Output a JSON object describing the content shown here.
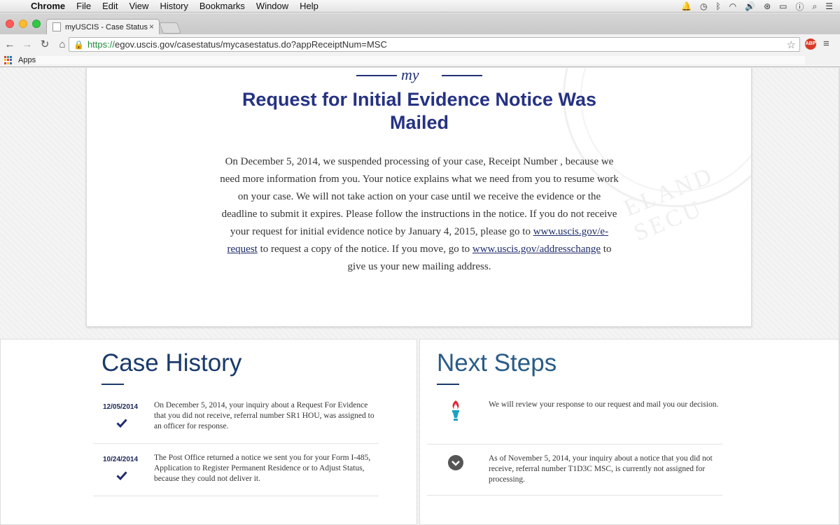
{
  "menubar": {
    "app": "Chrome",
    "items": [
      "File",
      "Edit",
      "View",
      "History",
      "Bookmarks",
      "Window",
      "Help"
    ]
  },
  "browser": {
    "tab_title": "myUSCIS - Case Status",
    "url_https": "https://",
    "url_rest": "egov.uscis.gov/casestatus/mycasestatus.do?appReceiptNum=MSC",
    "apps_label": "Apps",
    "abp_label": "ABP"
  },
  "status": {
    "logo_text": "my",
    "title": "Request for Initial Evidence Notice Was Mailed",
    "body_part1": "On December 5, 2014, we suspended processing of your case, Receipt Number , because we need more information from you. Your notice explains what we need from you to resume work on your case. We will not take action on your case until we receive the evidence or the deadline to submit it expires. Please follow the instructions in the notice. If you do not receive your request for initial evidence notice by January 4, 2015, please go to ",
    "link1": "www.uscis.gov/e-request",
    "body_part2": " to request a copy of the notice. If you move, go to ",
    "link2": "www.uscis.gov/addresschange",
    "body_part3": " to give us your new mailing address."
  },
  "case_history": {
    "title": "Case History",
    "items": [
      {
        "date": "12/05/2014",
        "text": "On December 5, 2014, your inquiry about a Request For Evidence that you did not receive, referral number SR1 HOU, was assigned to an officer for response."
      },
      {
        "date": "10/24/2014",
        "text": "The Post Office returned a notice we sent you for your Form I-485, Application to Register Permanent Residence or to Adjust Status, because they could not deliver it."
      }
    ]
  },
  "next_steps": {
    "title": "Next Steps",
    "items": [
      {
        "icon": "torch-icon",
        "text": "We will review your response to our request and mail you our decision."
      },
      {
        "icon": "chevron-down-icon",
        "text": "As of November 5, 2014, your inquiry about a notice that you did not receive, referral number T1D3C MSC, is currently not assigned for processing."
      }
    ]
  },
  "colors": {
    "title_navy": "#253283",
    "heading_blue": "#1a3a6b",
    "link": "#1d2a6b"
  }
}
